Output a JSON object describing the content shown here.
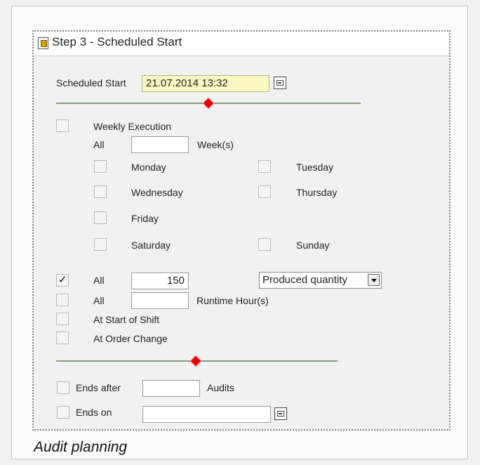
{
  "panel": {
    "title": "Step 3 - Scheduled Start",
    "icon": "document-icon"
  },
  "scheduled_start": {
    "label": "Scheduled Start",
    "value": "21.07.2014 13:32",
    "calendar_icon": "calendar-icon"
  },
  "weekly": {
    "label": "Weekly Execution",
    "checked": false,
    "all_label": "All",
    "weeks_value": "",
    "weeks_unit": "Week(s)",
    "days": [
      {
        "label": "Monday",
        "checked": false
      },
      {
        "label": "Tuesday",
        "checked": false
      },
      {
        "label": "Wednesday",
        "checked": false
      },
      {
        "label": "Thursday",
        "checked": false
      },
      {
        "label": "Friday",
        "checked": false
      },
      {
        "label": "Saturday",
        "checked": false
      },
      {
        "label": "Sunday",
        "checked": false
      }
    ]
  },
  "quantity": {
    "checked": true,
    "all_label": "All",
    "value": "150",
    "type_selected": "Produced quantity"
  },
  "runtime": {
    "checked": false,
    "all_label": "All",
    "value": "",
    "unit": "Runtime Hour(s)"
  },
  "shift_start": {
    "checked": false,
    "label": "At Start of Shift"
  },
  "order_change": {
    "checked": false,
    "label": "At Order Change"
  },
  "ends_after": {
    "checked": false,
    "label": "Ends after",
    "value": "",
    "unit": "Audits"
  },
  "ends_on": {
    "checked": false,
    "label": "Ends on",
    "value": "",
    "calendar_icon": "calendar-icon"
  },
  "caption": "Audit planning",
  "colors": {
    "accent_diamond": "#e60000",
    "date_field_bg": "#fbf7c2"
  }
}
